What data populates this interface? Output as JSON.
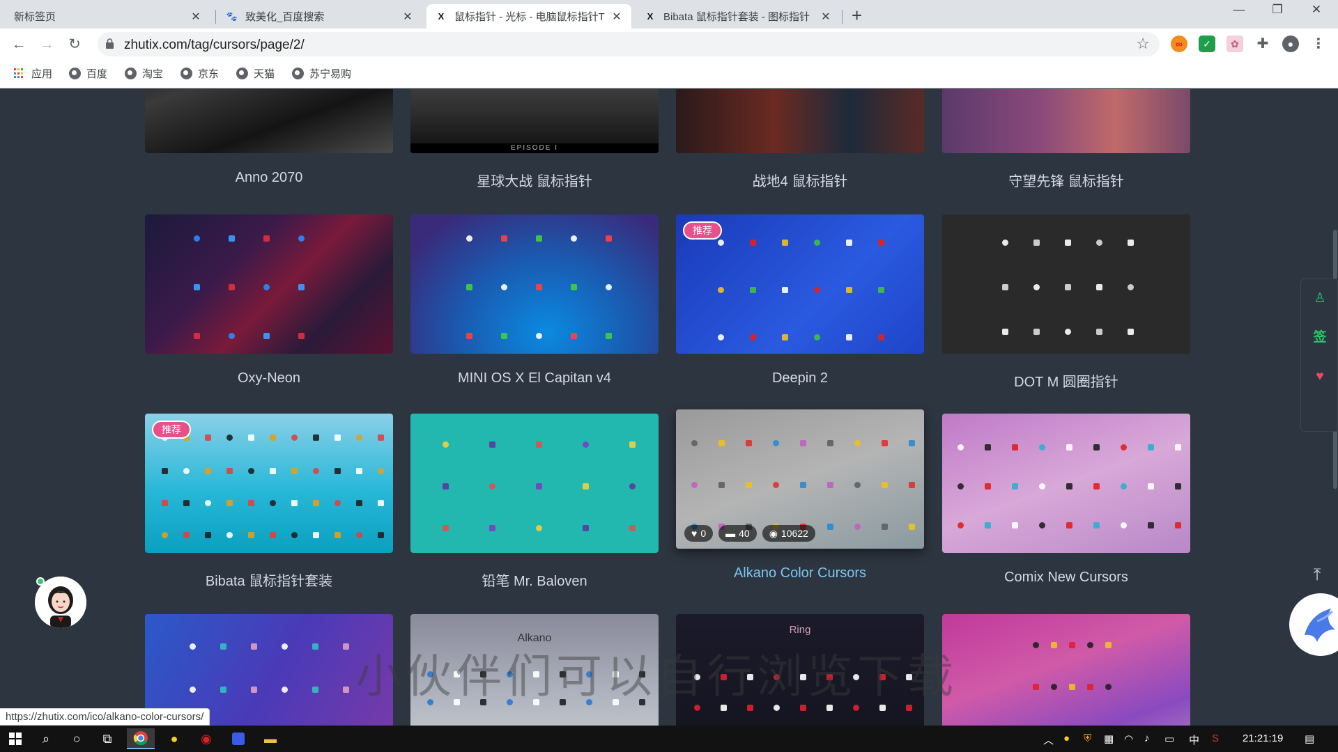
{
  "browser": {
    "tabs": [
      {
        "title": "新标签页",
        "favicon": "none"
      },
      {
        "title": "致美化_百度搜索",
        "favicon": "baidu-icon"
      },
      {
        "title": "鼠标指针 - 光标 - 电脑鼠标指针T",
        "favicon": "zhutix-icon",
        "active": true
      },
      {
        "title": "Bibata 鼠标指针套装 - 图标指针",
        "favicon": "zhutix-icon"
      }
    ],
    "new_tab": "+",
    "url": "zhutix.com/tag/cursors/page/2/",
    "bookmarks": [
      "应用",
      "百度",
      "淘宝",
      "京东",
      "天猫",
      "苏宁易购"
    ]
  },
  "cards": [
    {
      "title": "Anno 2070",
      "style": "anno"
    },
    {
      "title": "星球大战 鼠标指针",
      "style": "starwars",
      "subtitle": "EPISODE I"
    },
    {
      "title": "战地4 鼠标指针",
      "style": "bf4"
    },
    {
      "title": "守望先锋 鼠标指针",
      "style": "overwatch"
    },
    {
      "title": "Oxy-Neon",
      "style": "oxy"
    },
    {
      "title": "MINI OS X El Capitan v4",
      "style": "mini"
    },
    {
      "title": "Deepin 2",
      "style": "deepin",
      "badge": "推荐"
    },
    {
      "title": "DOT M 圆圈指针",
      "style": "dotm"
    },
    {
      "title": "Bibata 鼠标指针套装",
      "style": "bibata",
      "badge": "推荐"
    },
    {
      "title": "铅笔 Mr. Baloven",
      "style": "pencil"
    },
    {
      "title": "Alkano Color Cursors",
      "style": "alkano",
      "hover": true,
      "stats": {
        "likes": "0",
        "comments": "40",
        "views": "10622"
      }
    },
    {
      "title": "Comix New Cursors",
      "style": "comix"
    },
    {
      "title": "",
      "style": "blue-purple"
    },
    {
      "title": "",
      "style": "alkano2",
      "label": "Alkano"
    },
    {
      "title": "",
      "style": "ring",
      "label": "Ring"
    },
    {
      "title": "",
      "style": "pink"
    }
  ],
  "watermark": "小伙伴们可以自行浏览下载",
  "float_bar": {
    "sign_label": "签"
  },
  "status_url": "https://zhutix.com/ico/alkano-color-cursors/",
  "taskbar": {
    "ime": "中",
    "time": "21:21:19"
  }
}
